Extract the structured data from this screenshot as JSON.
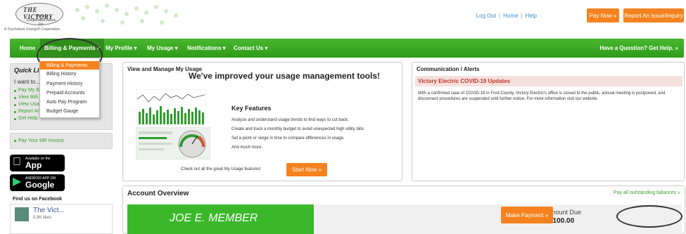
{
  "header": {
    "logo_title": "THE VICTORY",
    "logo_sub": "Electric Cooperative Assoc, Inc.",
    "tagline": "A Touchstone Energy® Cooperative",
    "toplinks": [
      "Log Out",
      "Home",
      "Help"
    ],
    "pay_now": "Pay Now »",
    "report": "Report An Issue/Inquiry"
  },
  "nav": {
    "items": [
      "Home",
      "Billing & Payments ▾",
      "My Profile ▾",
      "My Usage ▾",
      "Notifications ▾",
      "Contact Us ▾"
    ],
    "help": "Have a Question? Get Help. »"
  },
  "dropdown": {
    "items": [
      "Billing & Payments",
      "Billing History",
      "Payment History",
      "Prepaid Accounts",
      "Auto Pay Program",
      "Budget Gauge"
    ]
  },
  "sidebar": {
    "quick_title": "Quick Lin",
    "want": "I want to...",
    "links": [
      "Pay My B",
      "View Billi",
      "View Usag",
      "Report An",
      "Get Help"
    ],
    "mr_invoice": "Pay Your MR Invoice",
    "app_store_small": "Available on the",
    "app_store_big": "App Store",
    "google_small": "ANDROID APP ON",
    "google_big": "Google play",
    "fb_title": "Find us on Facebook",
    "fb_name": "The Vict...",
    "fb_likes": "5.9K likes"
  },
  "usage": {
    "title": "View and Manage My Usage",
    "headline": "We've improved your usage management tools!",
    "kf_title": "Key Features",
    "kf_items": [
      "Analyze and understand usage trends to find ways to cut back.",
      "Create and track a monthly budget to avoid unexpected high utility bills.",
      "Set a point or range in time to compare differences in usage.",
      "And much more."
    ],
    "check_text": "Check out all the great My Usage features!",
    "start_now": "Start Now »"
  },
  "comm": {
    "title": "Communication / Alerts",
    "covid_title": "Victory Electric COVID-19 Updates",
    "covid_text": "With a confirmed case of COVID-19 in Ford County, Victory Electric's office is closed to the public, annual meeting is postponed, and disconnect procedures are suspended until further notice. For more information visit our website."
  },
  "overview": {
    "title": "Account Overview",
    "link": "Pay all outstanding balances »",
    "member": "JOE E. MEMBER",
    "amount_label": "Amount Due",
    "amount_value": "$100.00",
    "make_payment": "Make Payment »"
  },
  "colors": {
    "green": "#3ab82a",
    "orange": "#f5821f",
    "alert": "#c0392b"
  }
}
